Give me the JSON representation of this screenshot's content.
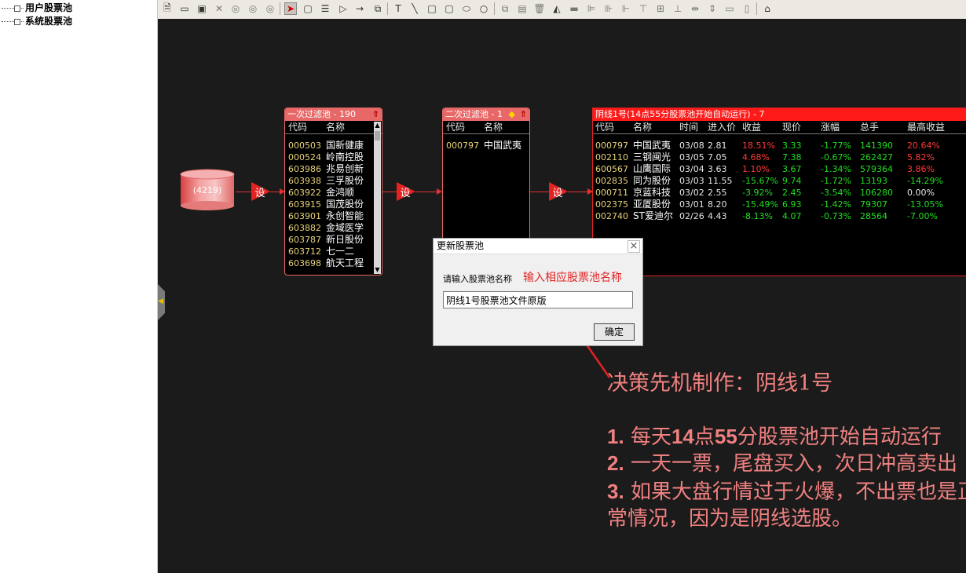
{
  "sidebar": {
    "items": [
      {
        "label": "用户股票池"
      },
      {
        "label": "系统股票池"
      }
    ]
  },
  "toolbar": {
    "icons": [
      "page-icon",
      "open-folder-icon",
      "save-icon",
      "delete-icon",
      "play-icon",
      "pause-icon",
      "stop-icon",
      "select-pointer-icon",
      "rounded-rect-icon",
      "list-icon",
      "triangle-icon",
      "arrow-right-icon",
      "copy-box-icon",
      "text-tool-icon",
      "line-tool-icon",
      "square-tool-icon",
      "rounded-square-tool-icon",
      "ellipse-tool-icon",
      "circle-tool-icon",
      "copy-icon",
      "paste-icon",
      "trash-icon",
      "fill-icon",
      "line-style-icon",
      "align-left-icon",
      "align-center-icon",
      "align-right-icon",
      "align-top-icon",
      "align-middle-icon",
      "align-bottom-icon",
      "space-h-icon",
      "space-v-icon",
      "grid-icon"
    ]
  },
  "source": {
    "label": "(4219)"
  },
  "filter_label": "设",
  "panel1": {
    "title": "一次过滤池 - 190",
    "headers": [
      "代码",
      "名称"
    ],
    "rows": [
      [
        "000503",
        "国新健康"
      ],
      [
        "000524",
        "岭南控股"
      ],
      [
        "603986",
        "兆易创新"
      ],
      [
        "603938",
        "三孚股份"
      ],
      [
        "603922",
        "金鸿顺"
      ],
      [
        "603915",
        "国茂股份"
      ],
      [
        "603901",
        "永创智能"
      ],
      [
        "603882",
        "金域医学"
      ],
      [
        "603787",
        "新日股份"
      ],
      [
        "603712",
        "七一二"
      ],
      [
        "603698",
        "航天工程"
      ]
    ]
  },
  "panel2": {
    "title": "二次过滤池 - 1",
    "headers": [
      "代码",
      "名称"
    ],
    "rows": [
      [
        "000797",
        "中国武夷"
      ]
    ]
  },
  "panel3": {
    "title": "阴线1号(14点55分股票池开始自动运行) - 7",
    "headers": [
      "代码",
      "名称",
      "时间",
      "进入价",
      "收益",
      "现价",
      "涨幅",
      "总手",
      "最高收益"
    ],
    "rows": [
      {
        "code": "000797",
        "name": "中国武夷",
        "time": "03/08",
        "entry": "2.81",
        "gain": "18.51%",
        "price": "3.33",
        "change": "-1.77%",
        "volume": "141390",
        "max": "20.64%"
      },
      {
        "code": "002110",
        "name": "三钢闽光",
        "time": "03/05",
        "entry": "7.05",
        "gain": "4.68%",
        "price": "7.38",
        "change": "-0.67%",
        "volume": "262427",
        "max": "5.82%"
      },
      {
        "code": "600567",
        "name": "山鹰国际",
        "time": "03/04",
        "entry": "3.63",
        "gain": "1.10%",
        "price": "3.67",
        "change": "-1.34%",
        "volume": "579364",
        "max": "3.86%"
      },
      {
        "code": "002835",
        "name": "同为股份",
        "time": "03/03",
        "entry": "11.55",
        "gain": "-15.67%",
        "price": "9.74",
        "change": "-1.72%",
        "volume": "13193",
        "max": "-14.29%"
      },
      {
        "code": "000711",
        "name": "京蓝科技",
        "time": "03/02",
        "entry": "2.55",
        "gain": "-3.92%",
        "price": "2.45",
        "change": "-3.54%",
        "volume": "106280",
        "max": "0.00%"
      },
      {
        "code": "002375",
        "name": "亚厦股份",
        "time": "03/01",
        "entry": "8.20",
        "gain": "-15.49%",
        "price": "6.93",
        "change": "-1.42%",
        "volume": "79307",
        "max": "-13.05%"
      },
      {
        "code": "002740",
        "name": "ST爱迪尔",
        "time": "02/26",
        "entry": "4.43",
        "gain": "-8.13%",
        "price": "4.07",
        "change": "-0.73%",
        "volume": "28564",
        "max": "-7.00%"
      }
    ]
  },
  "dialog": {
    "title": "更新股票池",
    "close": "×",
    "prompt": "请输入股票池名称",
    "input_value": "阴线1号股票池文件原版",
    "ok": "确定"
  },
  "annotations": {
    "hint": "输入相应股票池名称",
    "title": "决策先机制作：阴线1号",
    "item1_num": "1.",
    "item1_a": "每天",
    "item1_b": "14",
    "item1_c": "点",
    "item1_d": "55",
    "item1_e": "分股票池开始自动运行",
    "item2_num": "2.",
    "item2": "一天一票，尾盘买入，次日冲高卖出",
    "item3_num": "3.",
    "item3": "如果大盘行情过于火爆，不出票也是正",
    "item3_cont": "常情况，因为是阴线选股。"
  },
  "colors": {
    "canvas": "#1c1b1b",
    "accent_red": "#e32222",
    "panel_title": "#e86868",
    "rise": "#ff3838",
    "fall": "#22dd22",
    "note": "#f08080"
  }
}
